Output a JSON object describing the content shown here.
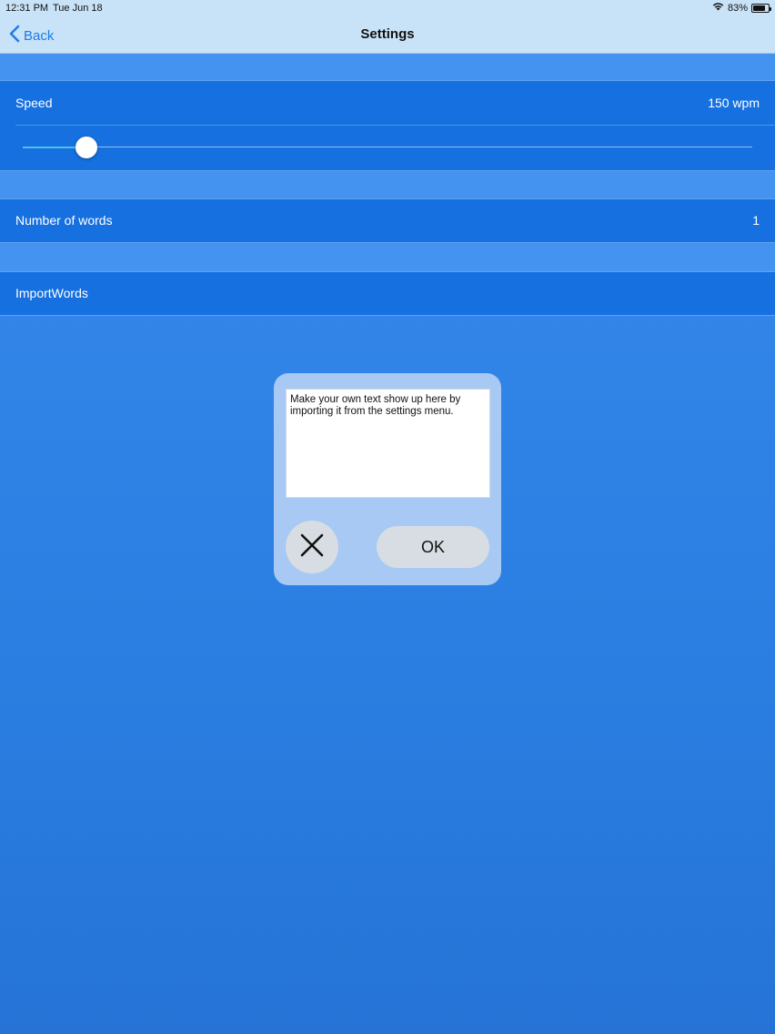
{
  "status_bar": {
    "time": "12:31 PM",
    "date": "Tue Jun 18",
    "battery": "83%",
    "battery_level": 0.83
  },
  "nav": {
    "back_label": "Back",
    "title": "Settings"
  },
  "speed": {
    "label": "Speed",
    "value": "150 wpm",
    "slider_fraction": 0.06
  },
  "words": {
    "label": "Number of words",
    "value": "1"
  },
  "import": {
    "label": "ImportWords"
  },
  "dialog": {
    "text": "Make your own text show up here by importing it from the settings menu.",
    "ok_label": "OK"
  },
  "colors": {
    "accent": "#1d7bea",
    "cell": "#1670e0",
    "background": "#3f8eec"
  }
}
